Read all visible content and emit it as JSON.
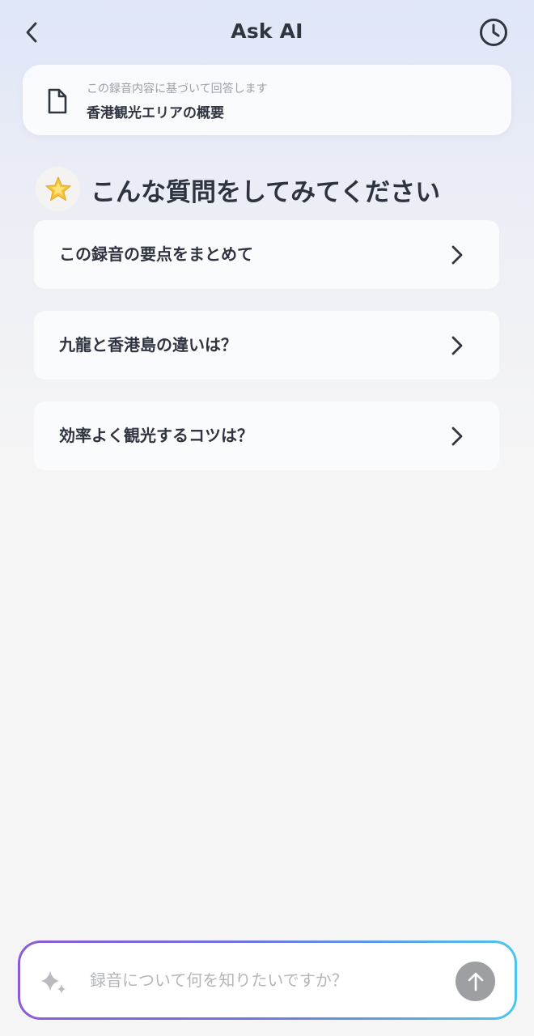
{
  "header": {
    "title": "Ask AI",
    "back_icon": "chevron-left-icon",
    "history_icon": "clock-icon"
  },
  "source": {
    "icon": "document-icon",
    "hint": "この録音内容に基づいて回答します",
    "title": "香港観光エリアの概要"
  },
  "suggestions": {
    "icon": "star-icon",
    "heading": "こんな質問をしてみてください",
    "items": [
      {
        "label": "この録音の要点をまとめて"
      },
      {
        "label": "九龍と香港島の違いは？"
      },
      {
        "label": "効率よく観光するコツは？"
      }
    ]
  },
  "composer": {
    "icon": "sparkle-icon",
    "value": "",
    "placeholder": "録音について何を知りたいですか？",
    "send_icon": "arrow-up-icon"
  },
  "colors": {
    "accent_gradient_start": "#8b5cd6",
    "accent_gradient_end": "#4cc4ec",
    "send_button": "#9d9fa3",
    "star": "#f6c43a"
  }
}
